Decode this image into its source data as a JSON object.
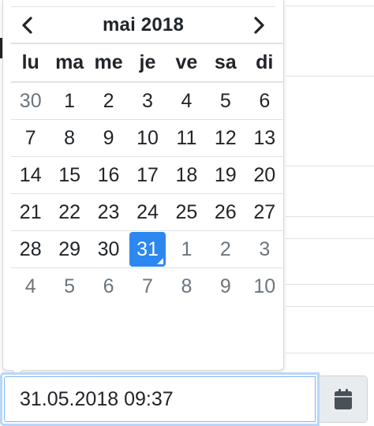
{
  "datepicker": {
    "month_label": "mai 2018",
    "prev_icon": "chevron-left-icon",
    "next_icon": "chevron-right-icon",
    "weekdays": [
      "lu",
      "ma",
      "me",
      "je",
      "ve",
      "sa",
      "di"
    ],
    "weeks": [
      [
        {
          "d": "30",
          "muted": true
        },
        {
          "d": "1"
        },
        {
          "d": "2"
        },
        {
          "d": "3"
        },
        {
          "d": "4"
        },
        {
          "d": "5"
        },
        {
          "d": "6"
        }
      ],
      [
        {
          "d": "7"
        },
        {
          "d": "8"
        },
        {
          "d": "9"
        },
        {
          "d": "10"
        },
        {
          "d": "11"
        },
        {
          "d": "12"
        },
        {
          "d": "13"
        }
      ],
      [
        {
          "d": "14"
        },
        {
          "d": "15"
        },
        {
          "d": "16"
        },
        {
          "d": "17"
        },
        {
          "d": "18"
        },
        {
          "d": "19"
        },
        {
          "d": "20"
        }
      ],
      [
        {
          "d": "21"
        },
        {
          "d": "22"
        },
        {
          "d": "23"
        },
        {
          "d": "24"
        },
        {
          "d": "25"
        },
        {
          "d": "26"
        },
        {
          "d": "27"
        }
      ],
      [
        {
          "d": "28"
        },
        {
          "d": "29"
        },
        {
          "d": "30"
        },
        {
          "d": "31",
          "active": true
        },
        {
          "d": "1",
          "muted": true
        },
        {
          "d": "2",
          "muted": true
        },
        {
          "d": "3",
          "muted": true
        }
      ],
      [
        {
          "d": "4",
          "muted": true
        },
        {
          "d": "5",
          "muted": true
        },
        {
          "d": "6",
          "muted": true
        },
        {
          "d": "7",
          "muted": true
        },
        {
          "d": "8",
          "muted": true
        },
        {
          "d": "9",
          "muted": true
        },
        {
          "d": "10",
          "muted": true
        }
      ]
    ],
    "active_color": "#2d87f0",
    "muted_color": "#6c757d"
  },
  "input": {
    "value": "31.05.2018 09:37"
  },
  "calendar_button": {
    "icon": "calendar-icon"
  }
}
